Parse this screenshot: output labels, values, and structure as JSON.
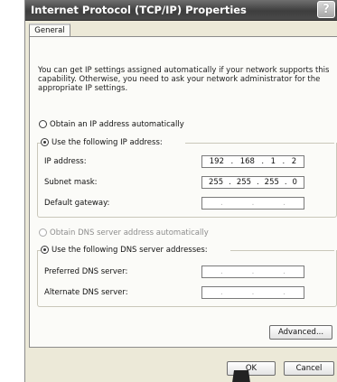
{
  "window": {
    "title": "Internet Protocol (TCP/IP) Properties",
    "help_glyph": "?"
  },
  "tab": {
    "label": "General"
  },
  "description": "You can get IP settings assigned automatically if your network supports this capability. Otherwise, you need to ask your network administrator for the appropriate IP settings.",
  "ip_section": {
    "auto_option": {
      "label": "Obtain an IP address automatically",
      "selected": false
    },
    "manual_option": {
      "label": "Use the following IP address:",
      "selected": true
    },
    "fields": [
      {
        "label": "IP address:",
        "octets": [
          "192",
          "168",
          "1",
          "2"
        ]
      },
      {
        "label": "Subnet mask:",
        "octets": [
          "255",
          "255",
          "255",
          "0"
        ]
      },
      {
        "label": "Default gateway:",
        "octets": [
          ".",
          ".",
          "."
        ]
      }
    ]
  },
  "dns_section": {
    "auto_option": {
      "label": "Obtain DNS server address automatically",
      "selected": false,
      "disabled": true
    },
    "manual_option": {
      "label": "Use the following DNS server addresses:",
      "selected": true
    },
    "fields": [
      {
        "label": "Preferred DNS server:",
        "octets": [
          ".",
          ".",
          "."
        ]
      },
      {
        "label": "Alternate DNS server:",
        "octets": [
          ".",
          ".",
          "."
        ]
      }
    ]
  },
  "buttons": {
    "advanced": "Advanced...",
    "ok": "OK",
    "cancel": "Cancel"
  }
}
